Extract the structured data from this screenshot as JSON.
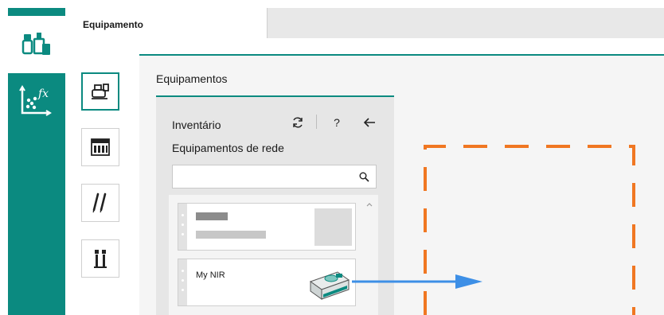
{
  "header": {
    "active_tab": "Equipamento"
  },
  "workspace": {
    "title": "Equipamentos"
  },
  "panel": {
    "title": "Inventário",
    "subtitle": "Equipamentos de rede",
    "help_label": "?",
    "search": {
      "value": "",
      "placeholder": ""
    }
  },
  "cards": [
    {
      "name": ""
    },
    {
      "name": "My NIR"
    }
  ],
  "colors": {
    "accent": "#0b8a80",
    "drop_target": "#f07722",
    "arrow": "#3d8fe6"
  },
  "icons": {
    "rail": [
      "instruments-icon",
      "formula-chart-icon"
    ],
    "tools": [
      "equipment-icon",
      "layout-icon",
      "pipettes-icon",
      "tubes-icon"
    ],
    "panel": [
      "refresh-icon",
      "help-icon",
      "back-arrow-icon",
      "search-icon"
    ]
  }
}
